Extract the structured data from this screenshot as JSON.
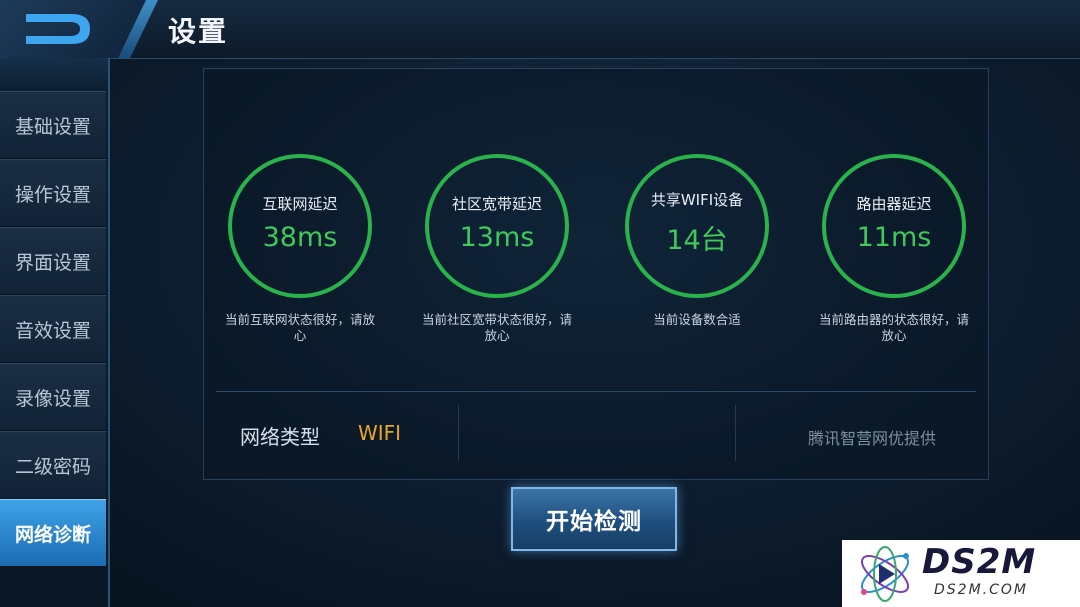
{
  "header": {
    "title": "设置"
  },
  "sidebar": {
    "items": [
      {
        "label": "基础设置",
        "active": false
      },
      {
        "label": "操作设置",
        "active": false
      },
      {
        "label": "界面设置",
        "active": false
      },
      {
        "label": "音效设置",
        "active": false
      },
      {
        "label": "录像设置",
        "active": false
      },
      {
        "label": "二级密码",
        "active": false
      },
      {
        "label": "网络诊断",
        "active": true
      }
    ]
  },
  "gauges": [
    {
      "title": "互联网延迟",
      "value": "38ms",
      "note": "当前互联网状态很好，请放心"
    },
    {
      "title": "社区宽带延迟",
      "value": "13ms",
      "note": "当前社区宽带状态很好，请放心"
    },
    {
      "title": "共享WIFI设备",
      "value": "14台",
      "note": "当前设备数合适"
    },
    {
      "title": "路由器延迟",
      "value": "11ms",
      "note": "当前路由器的状态很好，请放心"
    }
  ],
  "network": {
    "type_label": "网络类型",
    "type_value": "WIFI",
    "provider": "腾讯智营网优提供"
  },
  "start_button": {
    "label": "开始检测"
  },
  "watermark": {
    "big": "DS2M",
    "small": "DS2M.COM"
  },
  "colors": {
    "accent": "#3fa3e8",
    "gauge_ring": "#2ab34a",
    "gauge_value": "#3ec95a",
    "net_value": "#e8a628"
  }
}
